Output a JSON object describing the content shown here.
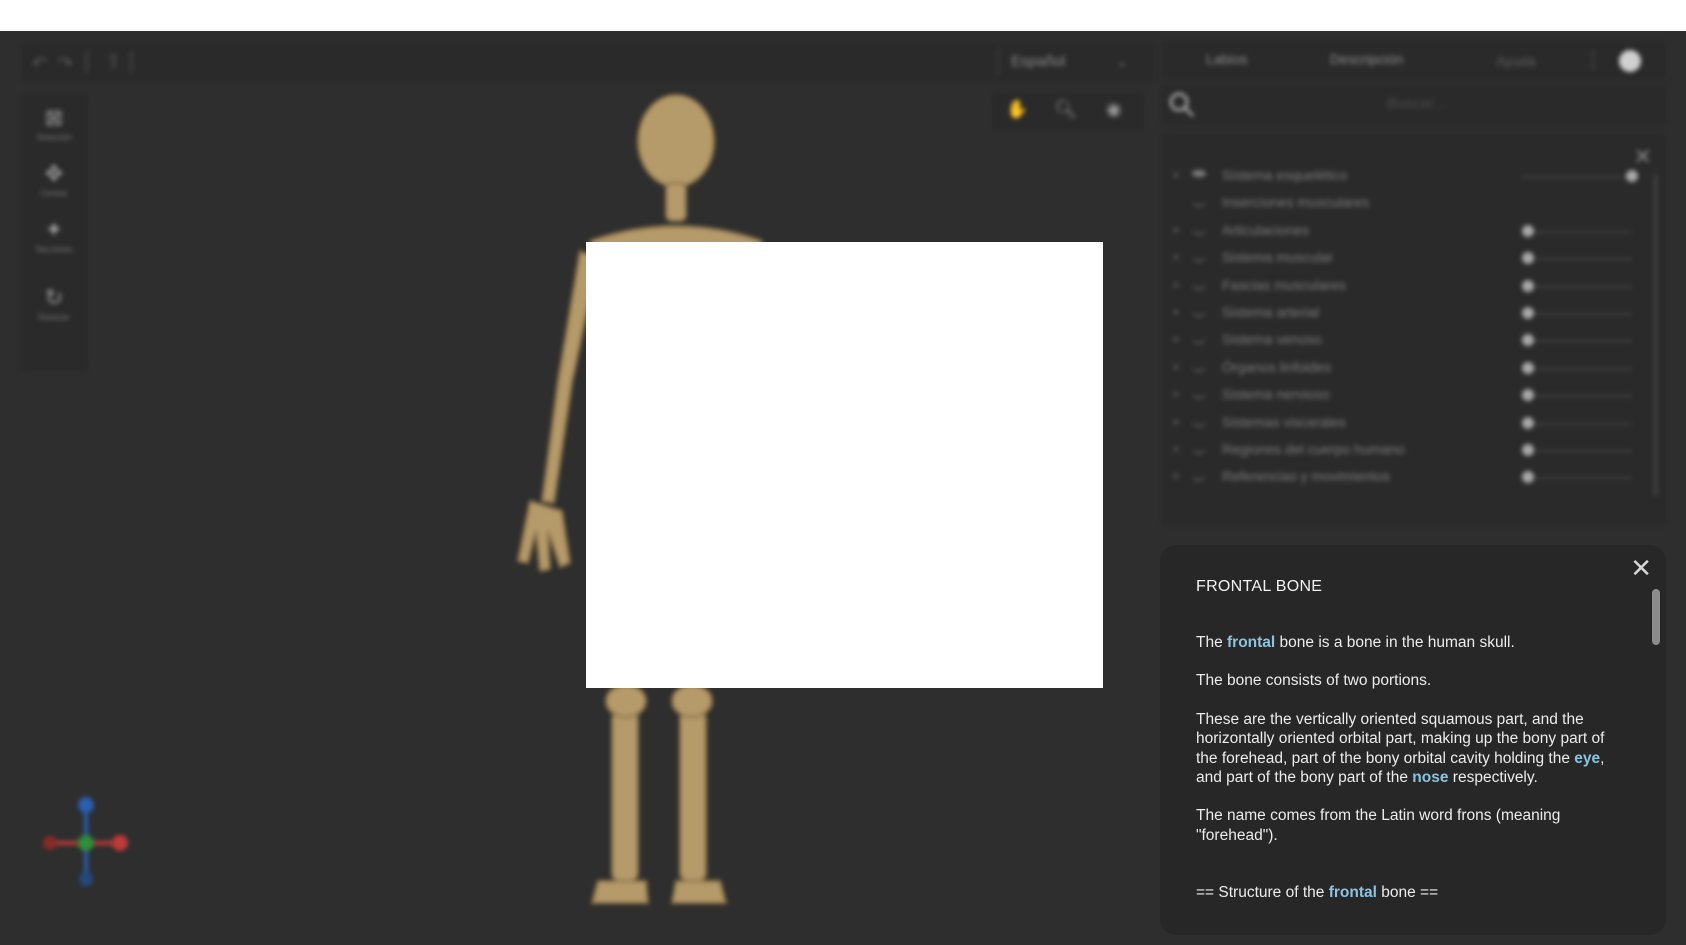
{
  "toolbar": {
    "undo_icon": "undo-icon",
    "redo_icon": "redo-icon",
    "export_icon": "export-icon",
    "language": "Español"
  },
  "tools": [
    {
      "icon": "select-icon",
      "label": "Selección"
    },
    {
      "icon": "move-icon",
      "label": "Centrar"
    },
    {
      "icon": "section-icon",
      "label": "Secciones"
    },
    {
      "icon": "reset-icon",
      "label": "Reiniciar"
    }
  ],
  "view_buttons": [
    "hand-icon",
    "zoom-icon",
    "eye-icon"
  ],
  "tabs": {
    "labels": "Labios",
    "description": "Descripción",
    "help": "Ayuda"
  },
  "search": {
    "placeholder": "Buscar..."
  },
  "layers": [
    {
      "name": "Sistema esquelético",
      "visible": true,
      "opacity": 1.0,
      "expandable": true
    },
    {
      "name": "Inserciones musculares",
      "visible": false,
      "opacity": null,
      "expandable": false
    },
    {
      "name": "Articulaciones",
      "visible": false,
      "opacity": 0.0,
      "expandable": true
    },
    {
      "name": "Sistema muscular",
      "visible": false,
      "opacity": 0.0,
      "expandable": true
    },
    {
      "name": "Fascias musculares",
      "visible": false,
      "opacity": 0.0,
      "expandable": true
    },
    {
      "name": "Sistema arterial",
      "visible": false,
      "opacity": 0.0,
      "expandable": true
    },
    {
      "name": "Sistema venoso",
      "visible": false,
      "opacity": 0.0,
      "expandable": true
    },
    {
      "name": "Órganos linfoides",
      "visible": false,
      "opacity": 0.0,
      "expandable": true
    },
    {
      "name": "Sistema nervioso",
      "visible": false,
      "opacity": 0.0,
      "expandable": true
    },
    {
      "name": "Sistemas viscerales",
      "visible": false,
      "opacity": 0.0,
      "expandable": true
    },
    {
      "name": "Regiones del cuerpo humano",
      "visible": false,
      "opacity": 0.0,
      "expandable": true
    },
    {
      "name": "Referencias y movimientos",
      "visible": false,
      "opacity": 0.0,
      "expandable": true
    }
  ],
  "description": {
    "title": "FRONTAL BONE",
    "p1_a": "The ",
    "p1_link": "frontal",
    "p1_b": " bone is a bone in the human skull.",
    "p2": "The bone consists of two portions.",
    "p3_a": "These are the vertically oriented squamous part, and the horizontally oriented orbital part, making up the bony part of the forehead, part of the bony orbital cavity holding the ",
    "p3_link1": "eye",
    "p3_b": ", and part of the bony part of the ",
    "p3_link2": "nose",
    "p3_c": " respectively.",
    "p4": "The name comes from the Latin word frons (meaning \"forehead\").",
    "structure_a": "== Structure of the ",
    "structure_link": "frontal",
    "structure_b": " bone =="
  },
  "colors": {
    "background": "#2e2e2e",
    "panel": "#2a2a2a",
    "desc_panel": "#272727",
    "link": "#8cc3df",
    "axis_x": "#c03a3a",
    "axis_y": "#2f8f3a",
    "axis_z": "#2a5fb0"
  }
}
